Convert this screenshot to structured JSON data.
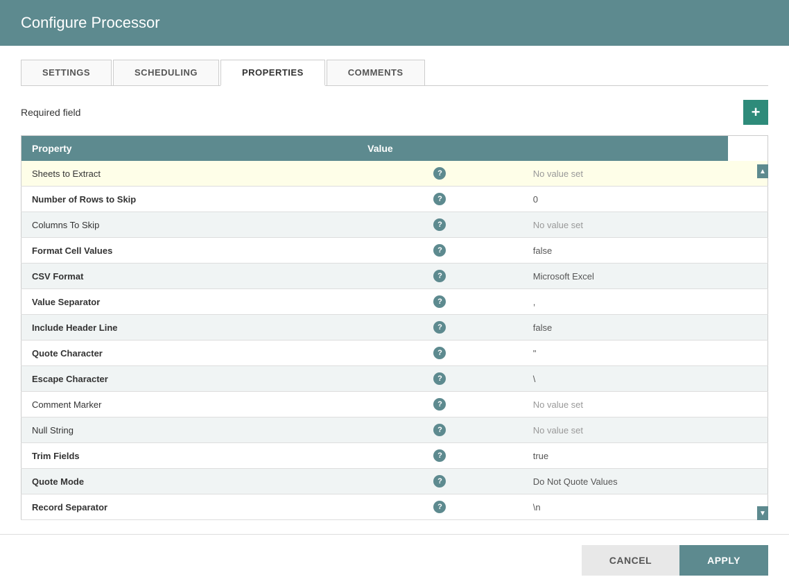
{
  "header": {
    "title": "Configure Processor"
  },
  "tabs": [
    {
      "id": "settings",
      "label": "SETTINGS",
      "active": false
    },
    {
      "id": "scheduling",
      "label": "SCHEDULING",
      "active": false
    },
    {
      "id": "properties",
      "label": "PROPERTIES",
      "active": true
    },
    {
      "id": "comments",
      "label": "COMMENTS",
      "active": false
    }
  ],
  "required_field_label": "Required field",
  "add_button_label": "+",
  "table": {
    "columns": [
      "Property",
      "Value"
    ],
    "rows": [
      {
        "property": "Sheets to Extract",
        "bold": false,
        "value": "No value set",
        "no_value": true,
        "required": true
      },
      {
        "property": "Number of Rows to Skip",
        "bold": true,
        "value": "0",
        "no_value": false,
        "required": false
      },
      {
        "property": "Columns To Skip",
        "bold": false,
        "value": "No value set",
        "no_value": true,
        "required": false
      },
      {
        "property": "Format Cell Values",
        "bold": true,
        "value": "false",
        "no_value": false,
        "required": false
      },
      {
        "property": "CSV Format",
        "bold": true,
        "value": "Microsoft Excel",
        "no_value": false,
        "required": false
      },
      {
        "property": "Value Separator",
        "bold": true,
        "value": ",",
        "no_value": false,
        "required": false
      },
      {
        "property": "Include Header Line",
        "bold": true,
        "value": "false",
        "no_value": false,
        "required": false
      },
      {
        "property": "Quote Character",
        "bold": true,
        "value": "\"",
        "no_value": false,
        "required": false
      },
      {
        "property": "Escape Character",
        "bold": true,
        "value": "\\",
        "no_value": false,
        "required": false
      },
      {
        "property": "Comment Marker",
        "bold": false,
        "value": "No value set",
        "no_value": true,
        "required": false
      },
      {
        "property": "Null String",
        "bold": false,
        "value": "No value set",
        "no_value": true,
        "required": false
      },
      {
        "property": "Trim Fields",
        "bold": true,
        "value": "true",
        "no_value": false,
        "required": false
      },
      {
        "property": "Quote Mode",
        "bold": true,
        "value": "Do Not Quote Values",
        "no_value": false,
        "required": false
      },
      {
        "property": "Record Separator",
        "bold": true,
        "value": "\\n",
        "no_value": false,
        "required": false
      }
    ]
  },
  "footer": {
    "cancel_label": "CANCEL",
    "apply_label": "APPLY"
  },
  "icons": {
    "help": "?",
    "scroll_up": "▲",
    "scroll_down": "▼",
    "add": "+"
  }
}
